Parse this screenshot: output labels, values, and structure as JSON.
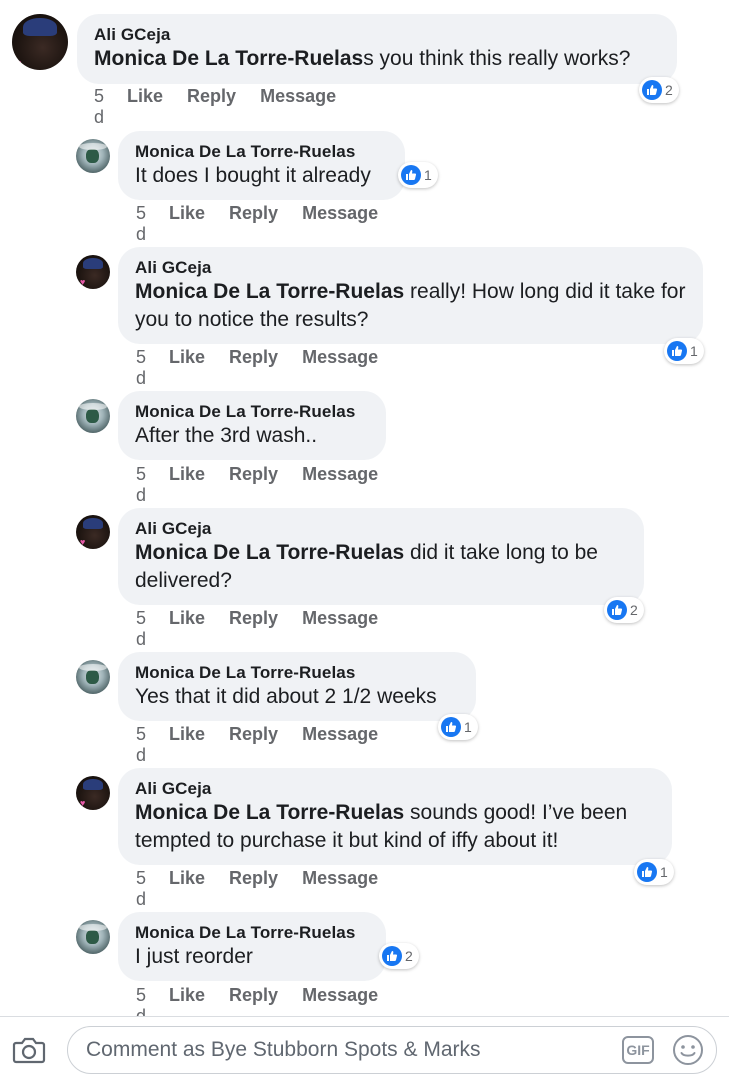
{
  "comments": [
    {
      "author": "Ali GCeja",
      "mention": "Monica De La Torre-Ruelas",
      "text": "s you think this really works?",
      "time": "5 d",
      "likes": "2"
    },
    {
      "author": "Monica De La Torre-Ruelas",
      "mention": "",
      "text": "It does I bought it already",
      "time": "5 d",
      "likes": "1"
    },
    {
      "author": "Ali GCeja",
      "mention": "Monica De La Torre-Ruelas",
      "text": " really! How long did it take for you to notice the results?",
      "time": "5 d",
      "likes": "1"
    },
    {
      "author": "Monica De La Torre-Ruelas",
      "mention": "",
      "text": "After the 3rd wash..",
      "time": "5 d",
      "likes": ""
    },
    {
      "author": "Ali GCeja",
      "mention": "Monica De La Torre-Ruelas",
      "text": " did it take long to be delivered?",
      "time": "5 d",
      "likes": "2"
    },
    {
      "author": "Monica De La Torre-Ruelas",
      "mention": "",
      "text": "Yes that it did about 2 1/2 weeks",
      "time": "5 d",
      "likes": "1"
    },
    {
      "author": "Ali GCeja",
      "mention": "Monica De La Torre-Ruelas",
      "text": " sounds good! I’ve been tempted to purchase it but kind of iffy about it!",
      "time": "5 d",
      "likes": "1"
    },
    {
      "author": "Monica De La Torre-Ruelas",
      "mention": "",
      "text": "I just reorder",
      "time": "5 d",
      "likes": "2"
    }
  ],
  "actions": {
    "like": "Like",
    "reply": "Reply",
    "message": "Message"
  },
  "composer": {
    "placeholder": "Comment as Bye Stubborn Spots & Marks",
    "gif_label": "GIF"
  },
  "icons": {
    "like": "thumbs-up-icon",
    "camera": "camera-icon",
    "emoji": "emoji-icon"
  },
  "colors": {
    "like_blue": "#1877f2",
    "bubble": "#f0f2f5",
    "muted": "#65676b"
  }
}
